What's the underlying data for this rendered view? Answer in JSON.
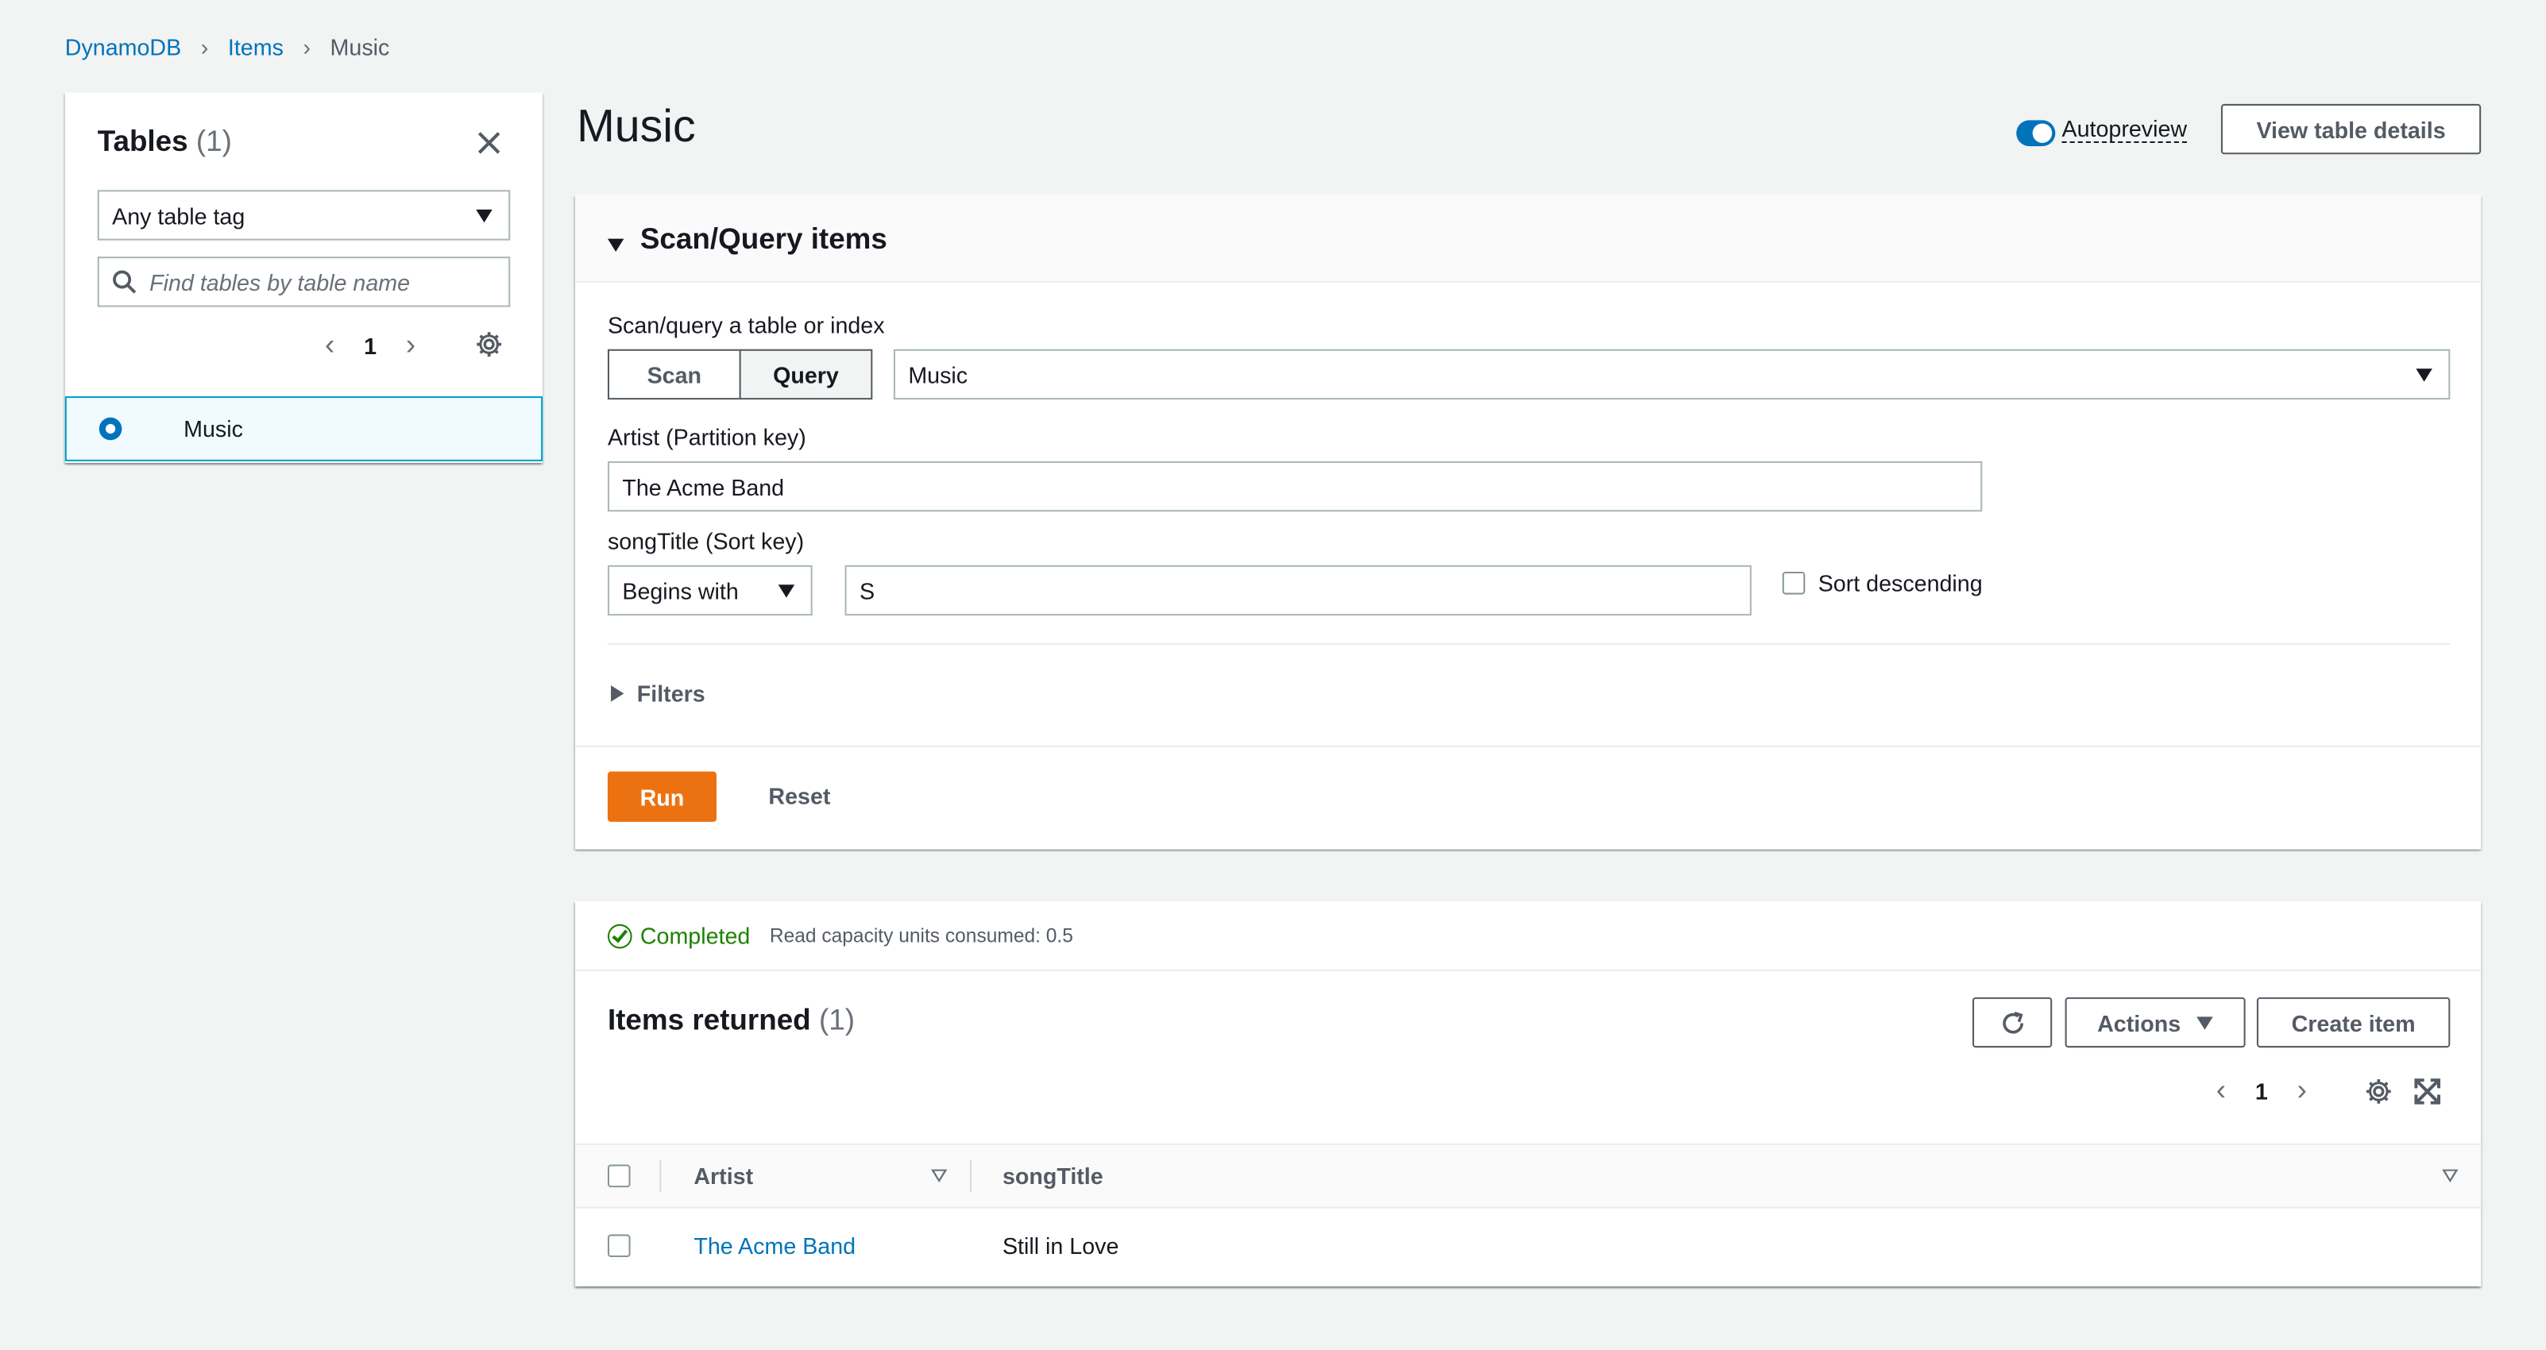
{
  "breadcrumb": {
    "items": [
      "DynamoDB",
      "Items"
    ],
    "current": "Music"
  },
  "tables_panel": {
    "title": "Tables",
    "count": "(1)",
    "tag_filter": "Any table tag",
    "search_placeholder": "Find tables by table name",
    "page": "1",
    "selected_table": "Music"
  },
  "header": {
    "title": "Music",
    "autopreview_label": "Autopreview",
    "view_details_label": "View table details"
  },
  "scan_query": {
    "title": "Scan/Query items",
    "mode_label": "Scan/query a table or index",
    "scan_label": "Scan",
    "query_label": "Query",
    "table_value": "Music",
    "partition_label": "Artist (Partition key)",
    "partition_value": "The Acme Band",
    "sort_label": "songTitle (Sort key)",
    "sort_condition": "Begins with",
    "sort_value": "S",
    "sort_desc_label": "Sort descending",
    "filters_label": "Filters",
    "run_label": "Run",
    "reset_label": "Reset"
  },
  "results": {
    "status": "Completed",
    "capacity": "Read capacity units consumed: 0.5",
    "title": "Items returned",
    "count": "(1)",
    "actions_label": "Actions",
    "create_label": "Create item",
    "page": "1",
    "columns": [
      "Artist",
      "songTitle"
    ],
    "rows": [
      {
        "artist": "The Acme Band",
        "songTitle": "Still in Love"
      }
    ]
  },
  "colors": {
    "accent": "#0073bb",
    "run": "#ec7211",
    "success": "#1d8102"
  }
}
